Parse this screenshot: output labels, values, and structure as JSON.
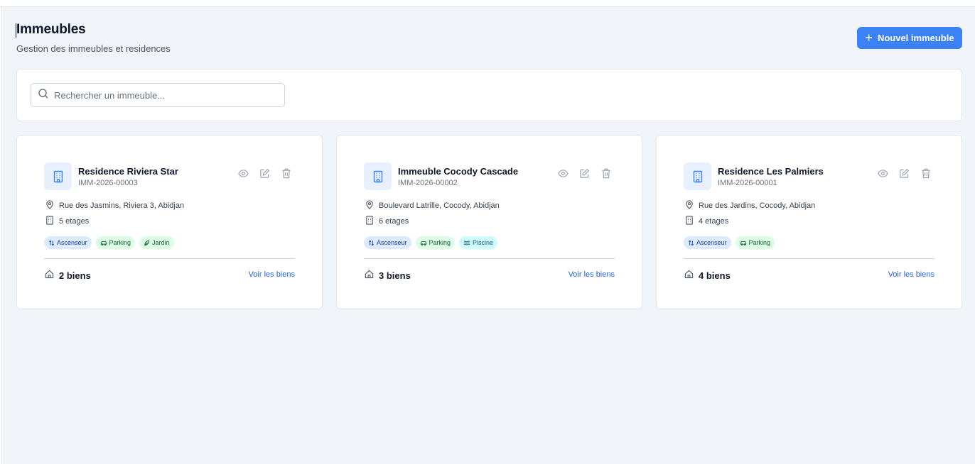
{
  "header": {
    "title": "Immeubles",
    "subtitle": "Gestion des immeubles et residences",
    "new_button_label": "Nouvel immeuble"
  },
  "search": {
    "placeholder": "Rechercher un immeuble...",
    "value": ""
  },
  "buildings": [
    {
      "name": "Residence Riviera Star",
      "ref": "IMM-2026-00003",
      "address": "Rue des Jasmins, Riviera 3, Abidjan",
      "floors": "5 etages",
      "amenities": [
        {
          "label": "Ascenseur",
          "color": "blue",
          "icon": "elevator-icon"
        },
        {
          "label": "Parking",
          "color": "green",
          "icon": "car-icon"
        },
        {
          "label": "Jardin",
          "color": "green",
          "icon": "leaf-icon"
        }
      ],
      "units": "2 biens",
      "link_label": "Voir les biens"
    },
    {
      "name": "Immeuble Cocody Cascade",
      "ref": "IMM-2026-00002",
      "address": "Boulevard Latrille, Cocody, Abidjan",
      "floors": "6 etages",
      "amenities": [
        {
          "label": "Ascenseur",
          "color": "blue",
          "icon": "elevator-icon"
        },
        {
          "label": "Parking",
          "color": "green",
          "icon": "car-icon"
        },
        {
          "label": "Piscine",
          "color": "cyan",
          "icon": "waves-icon"
        }
      ],
      "units": "3 biens",
      "link_label": "Voir les biens"
    },
    {
      "name": "Residence Les Palmiers",
      "ref": "IMM-2026-00001",
      "address": "Rue des Jardins, Cocody, Abidjan",
      "floors": "4 etages",
      "amenities": [
        {
          "label": "Ascenseur",
          "color": "blue",
          "icon": "elevator-icon"
        },
        {
          "label": "Parking",
          "color": "green",
          "icon": "car-icon"
        }
      ],
      "units": "4 biens",
      "link_label": "Voir les biens"
    }
  ],
  "colors": {
    "accent": "#3b82f6",
    "background": "#f0f3f8",
    "link": "#2563eb"
  }
}
